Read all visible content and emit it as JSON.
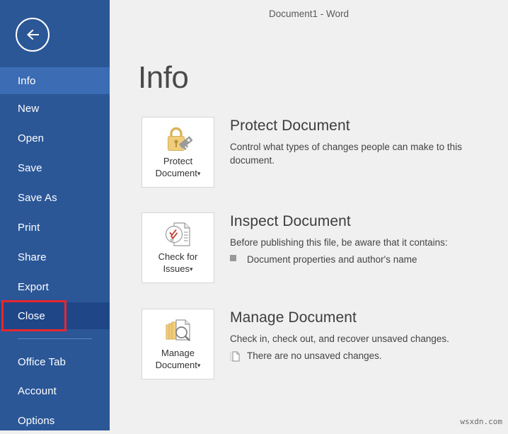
{
  "window": {
    "title": "Document1 - Word"
  },
  "sidebar": {
    "back_icon": "back-arrow-icon",
    "items": [
      {
        "label": "Info",
        "state": "active"
      },
      {
        "label": "New",
        "state": "normal"
      },
      {
        "label": "Open",
        "state": "normal"
      },
      {
        "label": "Save",
        "state": "normal"
      },
      {
        "label": "Save As",
        "state": "normal"
      },
      {
        "label": "Print",
        "state": "normal"
      },
      {
        "label": "Share",
        "state": "normal"
      },
      {
        "label": "Export",
        "state": "normal"
      },
      {
        "label": "Close",
        "state": "hovered"
      },
      {
        "label": "Office Tab",
        "state": "normal"
      },
      {
        "label": "Account",
        "state": "normal"
      },
      {
        "label": "Options",
        "state": "normal"
      }
    ],
    "highlight": {
      "target": "Close",
      "color": "#e8262d"
    },
    "colors": {
      "background": "#2b5797",
      "active": "#3b6cb4",
      "hover": "#1f4788",
      "divider": "#5d85c0"
    }
  },
  "main": {
    "page_title": "Info",
    "sections": [
      {
        "id": "protect-document",
        "button_label_line1": "Protect",
        "button_label_line2": "Document",
        "button_caret": "▾",
        "icon": "padlock-key-icon",
        "title": "Protect Document",
        "description": "Control what types of changes people can make to this document.",
        "bullets": []
      },
      {
        "id": "inspect-document",
        "button_label_line1": "Check for",
        "button_label_line2": "Issues",
        "button_caret": "▾",
        "icon": "document-inspect-icon",
        "title": "Inspect Document",
        "description": "Before publishing this file, be aware that it contains:",
        "bullets": [
          {
            "icon": "square-bullet-icon",
            "text": "Document properties and author's name"
          }
        ]
      },
      {
        "id": "manage-document",
        "button_label_line1": "Manage",
        "button_label_line2": "Document",
        "button_caret": "▾",
        "icon": "manage-documents-icon",
        "title": "Manage Document",
        "description": "Check in, check out, and recover unsaved changes.",
        "bullets": [
          {
            "icon": "unsaved-file-icon",
            "text": "There are no unsaved changes."
          }
        ]
      }
    ]
  },
  "watermark": "wsxdn.com"
}
